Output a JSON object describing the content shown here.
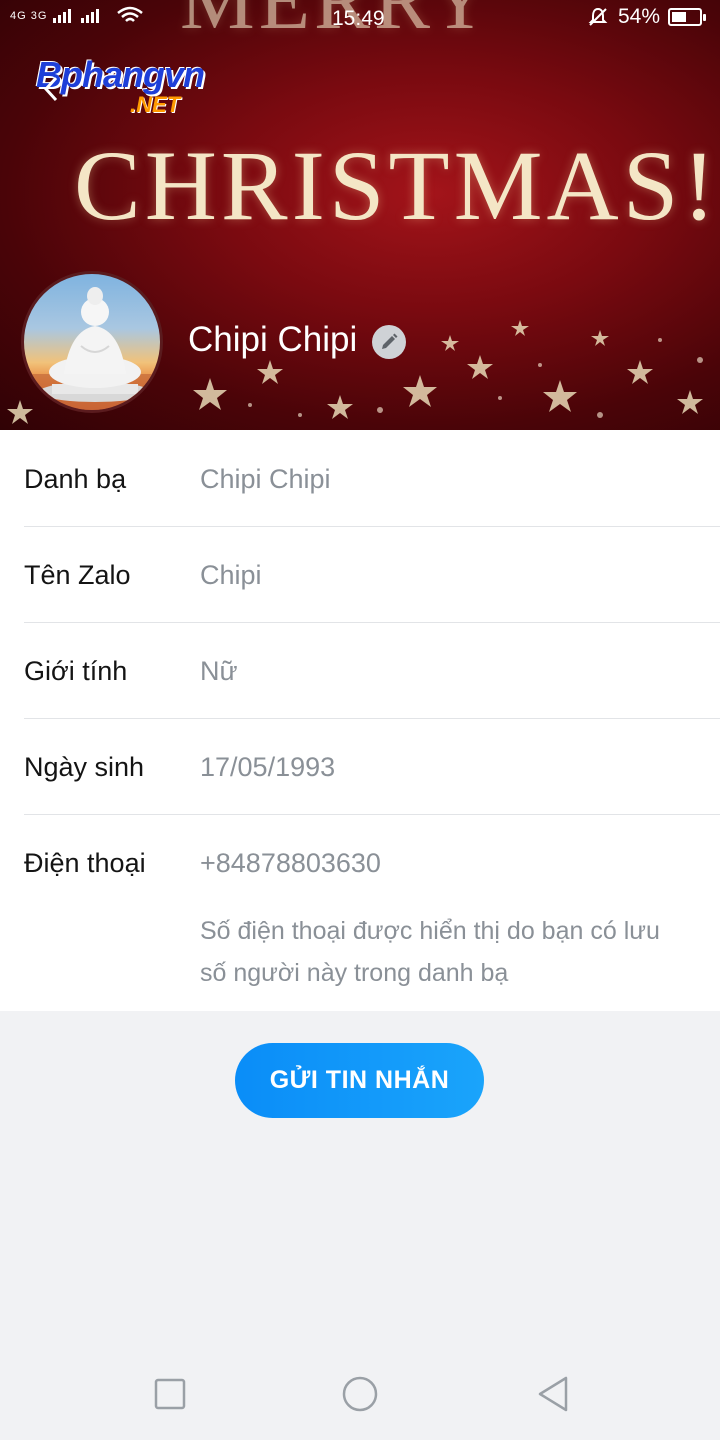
{
  "status_bar": {
    "network": "4G 3G",
    "time": "15:49",
    "battery": "54%",
    "battery_level": 0.54
  },
  "header": {
    "cover_text_top": "MERRY",
    "cover_text_main": "CHRISTMAS!",
    "watermark": {
      "brand": "Bphangvn",
      "suffix": ".NET"
    },
    "profile_name": "Chipi Chipi",
    "back_icon": "chevron-left-icon",
    "edit_icon": "pencil-icon"
  },
  "info": {
    "rows": [
      {
        "label": "Danh bạ",
        "value": "Chipi Chipi"
      },
      {
        "label": "Tên Zalo",
        "value": "Chipi"
      },
      {
        "label": "Giới tính",
        "value": "Nữ"
      },
      {
        "label": "Ngày sinh",
        "value": "17/05/1993"
      }
    ],
    "phone": {
      "label": "Điện thoại",
      "value": "+84878803630",
      "note": "Số điện thoại được hiển thị do bạn có lưu số người này trong danh bạ"
    }
  },
  "actions": {
    "send_message": "GỬI TIN NHẮN"
  },
  "colors": {
    "accent": "#0a8df8",
    "cover": "#7a0a10"
  }
}
